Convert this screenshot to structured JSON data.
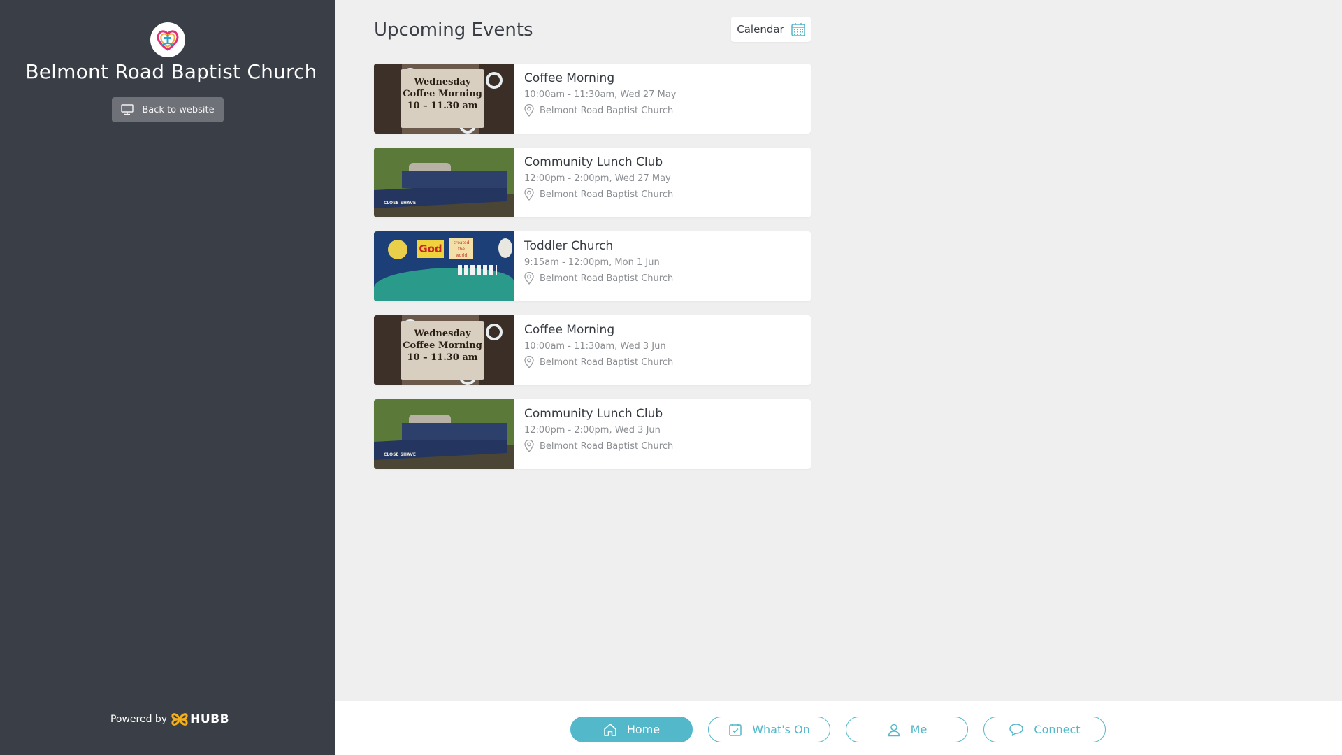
{
  "sidebar": {
    "church_name": "Belmont Road Baptist Church",
    "back_label": "Back to website",
    "powered_by": "Powered by",
    "brand": "HUBB"
  },
  "main": {
    "title": "Upcoming Events",
    "calendar_label": "Calendar",
    "events": [
      {
        "title": "Coffee Morning",
        "time": "10:00am - 11:30am, Wed 27 May",
        "location": "Belmont Road Baptist Church",
        "image": "coffee-morning-image",
        "image_text": "Wednesday Coffee Morning 10 - 11.30 am"
      },
      {
        "title": "Community Lunch Club",
        "time": "12:00pm - 2:00pm, Wed 27 May",
        "location": "Belmont Road Baptist Church",
        "image": "narrowboat-image",
        "image_text": "CLOSE SHAVE"
      },
      {
        "title": "Toddler Church",
        "time": "9:15am - 12:00pm, Mon 1 Jun",
        "location": "Belmont Road Baptist Church",
        "image": "god-created-the-world-image",
        "image_text": "God created the world"
      },
      {
        "title": "Coffee Morning",
        "time": "10:00am - 11:30am, Wed 3 Jun",
        "location": "Belmont Road Baptist Church",
        "image": "coffee-morning-image",
        "image_text": "Wednesday Coffee Morning 10 - 11.30 am"
      },
      {
        "title": "Community Lunch Club",
        "time": "12:00pm - 2:00pm, Wed 3 Jun",
        "location": "Belmont Road Baptist Church",
        "image": "narrowboat-image",
        "image_text": "CLOSE SHAVE"
      }
    ]
  },
  "bottom_nav": {
    "items": [
      {
        "label": "Home",
        "icon": "home-icon",
        "active": true
      },
      {
        "label": "What's On",
        "icon": "calendar-check-icon",
        "active": false
      },
      {
        "label": "Me",
        "icon": "user-icon",
        "active": false
      },
      {
        "label": "Connect",
        "icon": "chat-bubble-icon",
        "active": false
      }
    ]
  },
  "colors": {
    "sidebar_bg": "#3a3f47",
    "accent": "#53b8c9",
    "page_bg": "#efefef"
  }
}
